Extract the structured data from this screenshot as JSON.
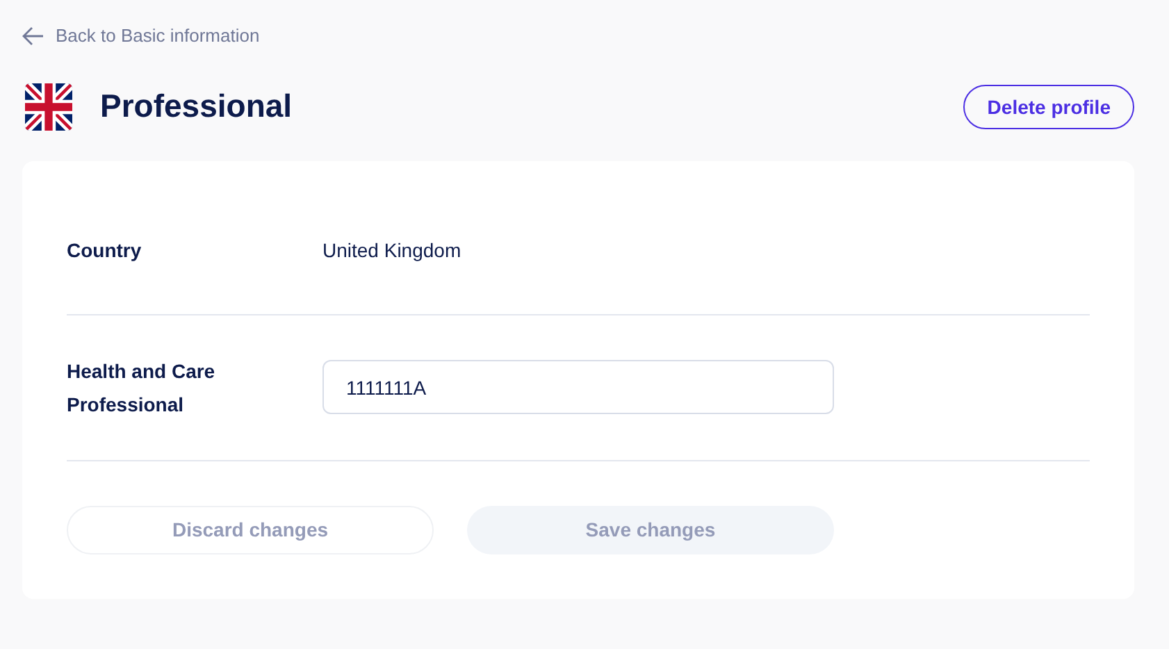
{
  "back_link": "Back to Basic information",
  "title": "Professional",
  "delete_button": "Delete profile",
  "fields": [
    {
      "kind": "text",
      "label": "Country",
      "value": "United Kingdom"
    },
    {
      "kind": "input",
      "label": "Health and Care Professional",
      "value": "1111111A"
    }
  ],
  "buttons": [
    {
      "kind": "outline",
      "label": "Discard changes",
      "disabled": true
    },
    {
      "kind": "filled",
      "label": "Save changes",
      "disabled": true
    }
  ]
}
